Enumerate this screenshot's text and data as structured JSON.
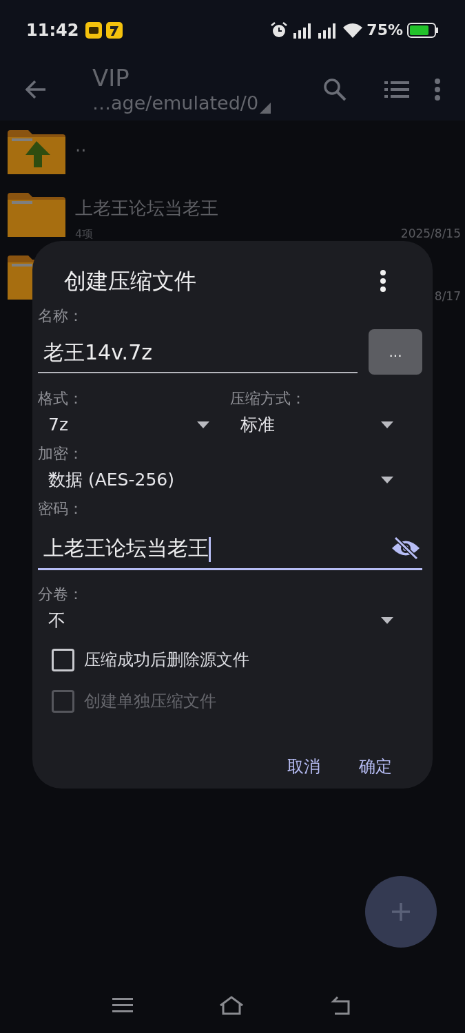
{
  "status_bar": {
    "time": "11:42",
    "battery": "75%"
  },
  "app_bar": {
    "title": "VIP",
    "path": "…age/emulated/0"
  },
  "files": [
    {
      "kind": "parent",
      "name": ".."
    },
    {
      "kind": "folder",
      "name": "上老王论坛当老王",
      "meta": "4项",
      "date": "2025/8/15"
    },
    {
      "kind": "folder",
      "date": "8/17"
    }
  ],
  "dialog": {
    "title": "创建压缩文件",
    "name": {
      "label": "名称：",
      "value": "老王14v.7z",
      "browse": "..."
    },
    "format": {
      "label": "格式：",
      "value": "7z"
    },
    "method": {
      "label": "压缩方式：",
      "value": "标准"
    },
    "encryption": {
      "label": "加密：",
      "value": "数据 (AES-256)"
    },
    "password": {
      "label": "密码：",
      "value": "上老王论坛当老王",
      "focused": true,
      "visible": true
    },
    "volume": {
      "label": "分卷：",
      "value": "不"
    },
    "checkboxes": [
      {
        "label": "压缩成功后删除源文件",
        "checked": false,
        "disabled": false
      },
      {
        "label": "创建单独压缩文件",
        "checked": false,
        "disabled": true
      }
    ],
    "buttons": [
      "取消",
      "确定"
    ]
  }
}
